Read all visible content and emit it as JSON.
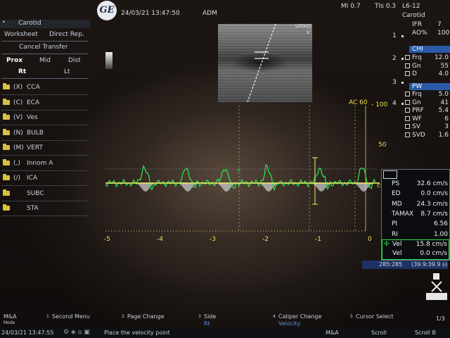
{
  "header": {
    "app": "Carotid",
    "datetime": "24/03/21 13:47:50",
    "operator": "ADM",
    "mi": "MI 0.7",
    "tis": "TIs 0.3",
    "probe": "L6-12",
    "preset": "Carotid",
    "logo_text": "GE",
    "logiq": "LOGIQ",
    "logiq_sub": "V"
  },
  "left_menu": {
    "worksheet": "Worksheet",
    "direct_rep": "Direct Rep.",
    "cancel_transfer": "Cancel Transfer",
    "prox": "Prox",
    "mid": "Mid",
    "dist": "Dist",
    "rt": "Rt",
    "lt": "Lt",
    "vessels": [
      {
        "code": "(X)",
        "name": "CCA"
      },
      {
        "code": "(C)",
        "name": "ECA"
      },
      {
        "code": "(V)",
        "name": "Ves"
      },
      {
        "code": "(N)",
        "name": "BULB"
      },
      {
        "code": "(M)",
        "name": "VERT"
      },
      {
        "code": "(,)",
        "name": "Innom A"
      },
      {
        "code": "(/)",
        "name": "ICA"
      },
      {
        "code": "",
        "name": "SUBC"
      },
      {
        "code": "",
        "name": "STA"
      }
    ]
  },
  "right_params": {
    "ifr_label": "IFR",
    "ifr_value": "7",
    "ao_label": "AO%",
    "ao_value": "100",
    "chi_header": "CHI",
    "chi": [
      {
        "label": "Frq",
        "value": "12.0"
      },
      {
        "label": "Gn",
        "value": "55"
      },
      {
        "label": "D",
        "value": "4.0"
      }
    ],
    "pw_header": "PW",
    "pw": [
      {
        "label": "Frq",
        "value": "5.0"
      },
      {
        "label": "Gn",
        "value": "41"
      },
      {
        "label": "PRF",
        "value": "5.4"
      },
      {
        "label": "WF",
        "value": "6"
      },
      {
        "label": "SV",
        "value": "3"
      },
      {
        "label": "SVD",
        "value": "1.6"
      }
    ],
    "depth_marks": [
      "1",
      "2",
      "3",
      "4"
    ]
  },
  "doppler": {
    "ac_label": "AC 60",
    "scale_100": "- 100",
    "scale_50": "50",
    "scale_cm": "cm",
    "time_labels": [
      "-5",
      "-4",
      "-3",
      "-2",
      "-1",
      "0"
    ],
    "counter": "285:285",
    "counter_range": "(39.9:39.9 s)"
  },
  "measurements": {
    "rows": [
      {
        "label": "PS",
        "value": "32.6 cm/s"
      },
      {
        "label": "ED",
        "value": "0.0 cm/s"
      },
      {
        "label": "MD",
        "value": "24.3 cm/s"
      },
      {
        "label": "TAMAX",
        "value": "8.7 cm/s"
      },
      {
        "label": "PI",
        "value": "6.56"
      },
      {
        "label": "RI",
        "value": "1.00"
      }
    ],
    "vel1_label": "Vel",
    "vel1_value": "15.8 cm/s",
    "vel2_label": "Vel",
    "vel2_value": "0.0 cm/s"
  },
  "bottom_bar": {
    "ma_mode": "M&A",
    "mode": "Mode",
    "items": [
      {
        "num": "1",
        "label": "Second Menu",
        "sub": ""
      },
      {
        "num": "2",
        "label": "Page Change",
        "sub": ""
      },
      {
        "num": "3",
        "label": "Side",
        "sub": "Rt"
      },
      {
        "num": "4",
        "label": "Caliper Change",
        "sub": "Velocity"
      },
      {
        "num": "5",
        "label": "Cursor Select",
        "sub": ""
      }
    ],
    "page": "1/3",
    "timestamp": "24/03/21 13:47:55",
    "prompt": "Place the velocity point",
    "ma": "M&A",
    "scroll": "Scroll",
    "scroll_b": "Scroll B"
  },
  "colors": {
    "trace": "#2ee04a",
    "baseline": "#f0f06a",
    "accent_blue": "#5c8fe0",
    "folder": "#d8c040"
  }
}
